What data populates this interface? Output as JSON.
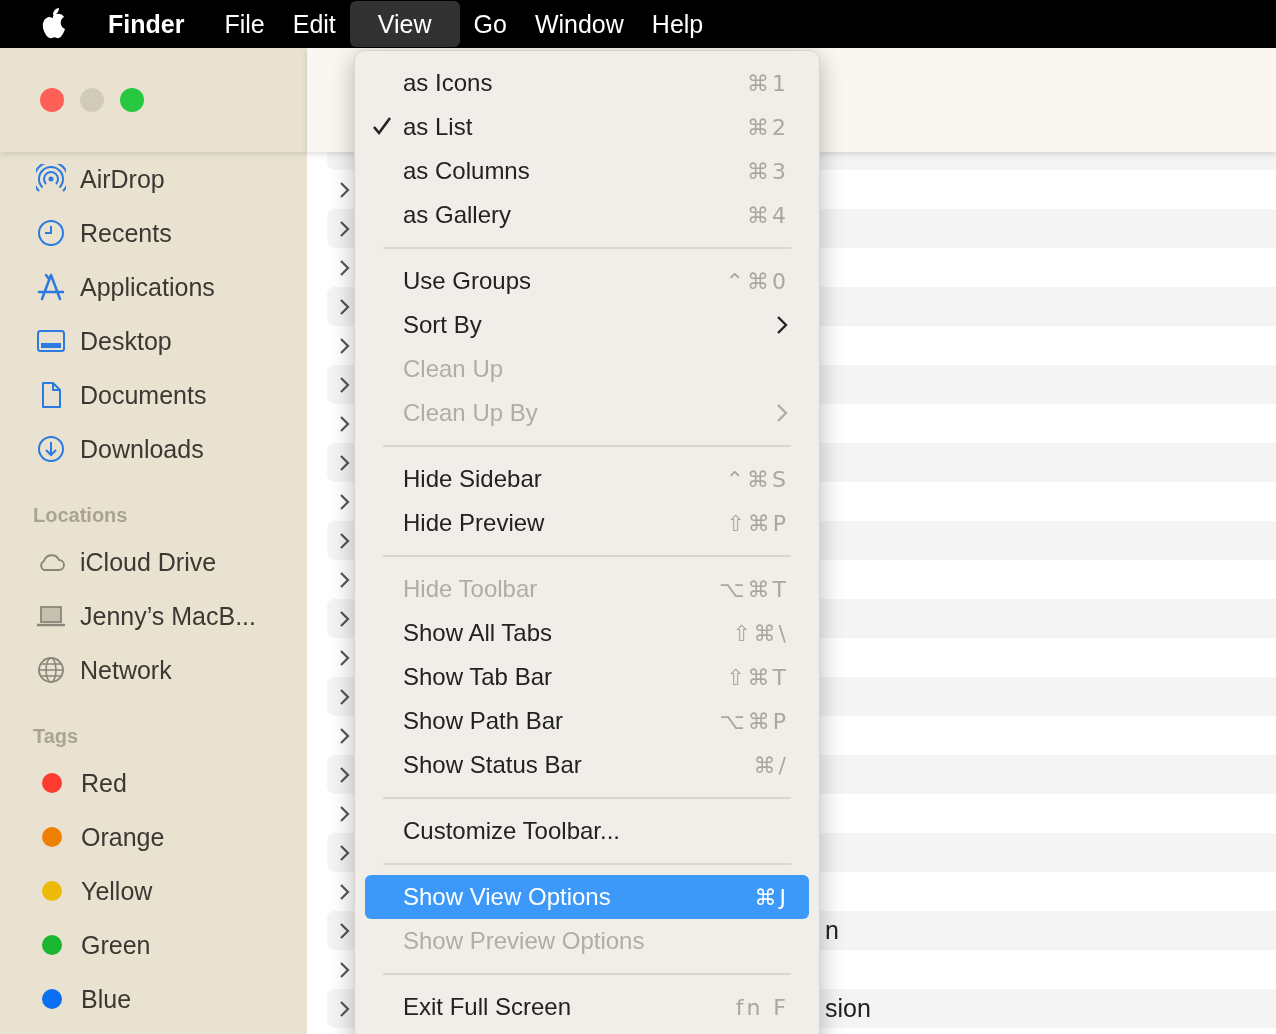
{
  "menu_bar": {
    "app_name": "Finder",
    "menus": [
      {
        "label": "File",
        "selected": false
      },
      {
        "label": "Edit",
        "selected": false
      },
      {
        "label": "View",
        "selected": true
      },
      {
        "label": "Go",
        "selected": false
      },
      {
        "label": "Window",
        "selected": false
      },
      {
        "label": "Help",
        "selected": false
      }
    ]
  },
  "window_controls": [
    {
      "kind": "close",
      "disabled": false
    },
    {
      "kind": "minimize",
      "disabled": true
    },
    {
      "kind": "zoom",
      "disabled": false
    }
  ],
  "sidebar": {
    "sections": [
      {
        "items": [
          {
            "label": "AirDrop",
            "selected": false
          },
          {
            "label": "Recents",
            "selected": false
          },
          {
            "label": "Applications",
            "selected": false
          },
          {
            "label": "Desktop",
            "selected": false
          },
          {
            "label": "Documents",
            "selected": false
          },
          {
            "label": "Downloads",
            "selected": false
          }
        ]
      },
      {
        "title": "Locations",
        "items": [
          {
            "label": "iCloud Drive",
            "selected": false
          },
          {
            "label": "Jenny’s MacB...",
            "selected": false
          },
          {
            "label": "Network",
            "selected": false
          }
        ]
      },
      {
        "title": "Tags",
        "items": [
          {
            "label": "Red",
            "color": "#fe3b30",
            "selected": false
          },
          {
            "label": "Orange",
            "color": "#ee8005",
            "selected": false
          },
          {
            "label": "Yellow",
            "color": "#efb907",
            "selected": false
          },
          {
            "label": "Green",
            "color": "#1ab630",
            "selected": false
          },
          {
            "label": "Blue",
            "color": "#0a6ff0",
            "selected": false
          }
        ]
      }
    ]
  },
  "file_list": {
    "rows": [
      {
        "expanded": false
      },
      {
        "expanded": false
      },
      {
        "expanded": false
      },
      {
        "expanded": false
      },
      {
        "expanded": false
      },
      {
        "expanded": false
      },
      {
        "expanded": false
      },
      {
        "expanded": false
      },
      {
        "expanded": false
      },
      {
        "expanded": false
      },
      {
        "expanded": false
      },
      {
        "expanded": false
      },
      {
        "expanded": false
      },
      {
        "expanded": false
      },
      {
        "expanded": false
      },
      {
        "expanded": false
      },
      {
        "expanded": false
      },
      {
        "expanded": false
      },
      {
        "expanded": false
      },
      {
        "expanded": false,
        "name": "n"
      },
      {
        "expanded": false
      },
      {
        "expanded": false,
        "name": "sion"
      }
    ]
  },
  "view_menu": {
    "items": [
      {
        "kind": "item",
        "label": "as Icons",
        "shortcut": "⌘1",
        "checked": false,
        "disabled": false,
        "selected": false,
        "submenu": false
      },
      {
        "kind": "item",
        "label": "as List",
        "shortcut": "⌘2",
        "checked": true,
        "disabled": false,
        "selected": false,
        "submenu": false
      },
      {
        "kind": "item",
        "label": "as Columns",
        "shortcut": "⌘3",
        "checked": false,
        "disabled": false,
        "selected": false,
        "submenu": false
      },
      {
        "kind": "item",
        "label": "as Gallery",
        "shortcut": "⌘4",
        "checked": false,
        "disabled": false,
        "selected": false,
        "submenu": false
      },
      {
        "kind": "separator"
      },
      {
        "kind": "item",
        "label": "Use Groups",
        "shortcut": "⌃⌘0",
        "checked": false,
        "disabled": false,
        "selected": false,
        "submenu": false
      },
      {
        "kind": "item",
        "label": "Sort By",
        "checked": false,
        "disabled": false,
        "selected": false,
        "submenu": true
      },
      {
        "kind": "item",
        "label": "Clean Up",
        "checked": false,
        "disabled": true,
        "selected": false,
        "submenu": false
      },
      {
        "kind": "item",
        "label": "Clean Up By",
        "checked": false,
        "disabled": true,
        "selected": false,
        "submenu": true
      },
      {
        "kind": "separator"
      },
      {
        "kind": "item",
        "label": "Hide Sidebar",
        "shortcut": "⌃⌘S",
        "checked": false,
        "disabled": false,
        "selected": false,
        "submenu": false
      },
      {
        "kind": "item",
        "label": "Hide Preview",
        "shortcut": "⇧⌘P",
        "checked": false,
        "disabled": false,
        "selected": false,
        "submenu": false
      },
      {
        "kind": "separator"
      },
      {
        "kind": "item",
        "label": "Hide Toolbar",
        "shortcut": "⌥⌘T",
        "checked": false,
        "disabled": true,
        "selected": false,
        "submenu": false
      },
      {
        "kind": "item",
        "label": "Show All Tabs",
        "shortcut": "⇧⌘\\",
        "checked": false,
        "disabled": false,
        "selected": false,
        "submenu": false
      },
      {
        "kind": "item",
        "label": "Show Tab Bar",
        "shortcut": "⇧⌘T",
        "checked": false,
        "disabled": false,
        "selected": false,
        "submenu": false
      },
      {
        "kind": "item",
        "label": "Show Path Bar",
        "shortcut": "⌥⌘P",
        "checked": false,
        "disabled": false,
        "selected": false,
        "submenu": false
      },
      {
        "kind": "item",
        "label": "Show Status Bar",
        "shortcut": "⌘/",
        "checked": false,
        "disabled": false,
        "selected": false,
        "submenu": false
      },
      {
        "kind": "separator"
      },
      {
        "kind": "item",
        "label": "Customize Toolbar...",
        "checked": false,
        "disabled": false,
        "selected": false,
        "submenu": false
      },
      {
        "kind": "separator"
      },
      {
        "kind": "item",
        "label": "Show View Options",
        "shortcut": "⌘J",
        "checked": false,
        "disabled": false,
        "selected": true,
        "submenu": false
      },
      {
        "kind": "item",
        "label": "Show Preview Options",
        "checked": false,
        "disabled": true,
        "selected": false,
        "submenu": false
      },
      {
        "kind": "separator"
      },
      {
        "kind": "item",
        "label": "Exit Full Screen",
        "shortcut": "fn F",
        "checked": false,
        "disabled": false,
        "selected": false,
        "submenu": false
      }
    ]
  }
}
